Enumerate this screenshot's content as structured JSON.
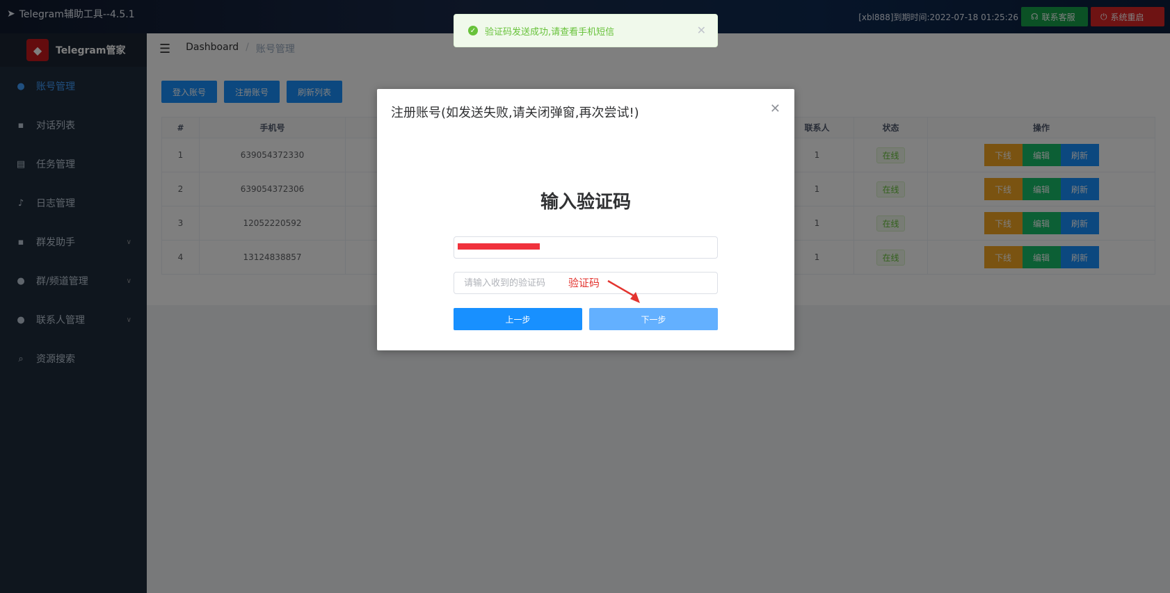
{
  "topbar": {
    "title": "Telegram辅助工具--4.5.1",
    "expire": "[xbl888]到期时间:2022-07-18 01:25:26",
    "service_btn": "联系客服",
    "restart_btn": "系统重启"
  },
  "sidebar": {
    "brand": "Telegram管家",
    "items": [
      {
        "label": "账号管理",
        "icon": "user-icon"
      },
      {
        "label": "对话列表",
        "icon": "chat-icon"
      },
      {
        "label": "任务管理",
        "icon": "document-icon"
      },
      {
        "label": "日志管理",
        "icon": "bell-icon"
      },
      {
        "label": "群发助手",
        "icon": "chat-icon"
      },
      {
        "label": "群/频道管理",
        "icon": "user-icon"
      },
      {
        "label": "联系人管理",
        "icon": "user-icon"
      },
      {
        "label": "资源搜索",
        "icon": "search-icon"
      }
    ]
  },
  "breadcrumb": {
    "home": "Dashboard",
    "sep": "/",
    "current": "账号管理"
  },
  "actions": {
    "login": "登入账号",
    "register": "注册账号",
    "refresh": "刷新列表"
  },
  "table": {
    "headers": {
      "idx": "#",
      "phone": "手机号",
      "contacts": "联系人",
      "status": "状态",
      "ops": "操作"
    },
    "rows": [
      {
        "idx": "1",
        "phone": "639054372330",
        "contacts": "1",
        "status": "在线"
      },
      {
        "idx": "2",
        "phone": "639054372306",
        "contacts": "1",
        "status": "在线"
      },
      {
        "idx": "3",
        "phone": "12052220592",
        "contacts": "1",
        "status": "在线"
      },
      {
        "idx": "4",
        "phone": "13124838857",
        "contacts": "1",
        "status": "在线"
      }
    ],
    "op_labels": {
      "offline": "下线",
      "edit": "编辑",
      "refresh": "刷新"
    }
  },
  "toast": {
    "message": "验证码发送成功,请查看手机短信"
  },
  "dialog": {
    "title": "注册账号(如发送失败,请关闭弹窗,再次尝试!)",
    "heading": "输入验证码",
    "code_placeholder": "请输入收到的验证码",
    "hint": "验证码",
    "prev_btn": "上一步",
    "next_btn": "下一步"
  },
  "colors": {
    "primary": "#1890ff",
    "success": "#19be6b",
    "warning": "#f5a623",
    "danger": "#dc2626",
    "sidebar": "#1f2d3d"
  }
}
